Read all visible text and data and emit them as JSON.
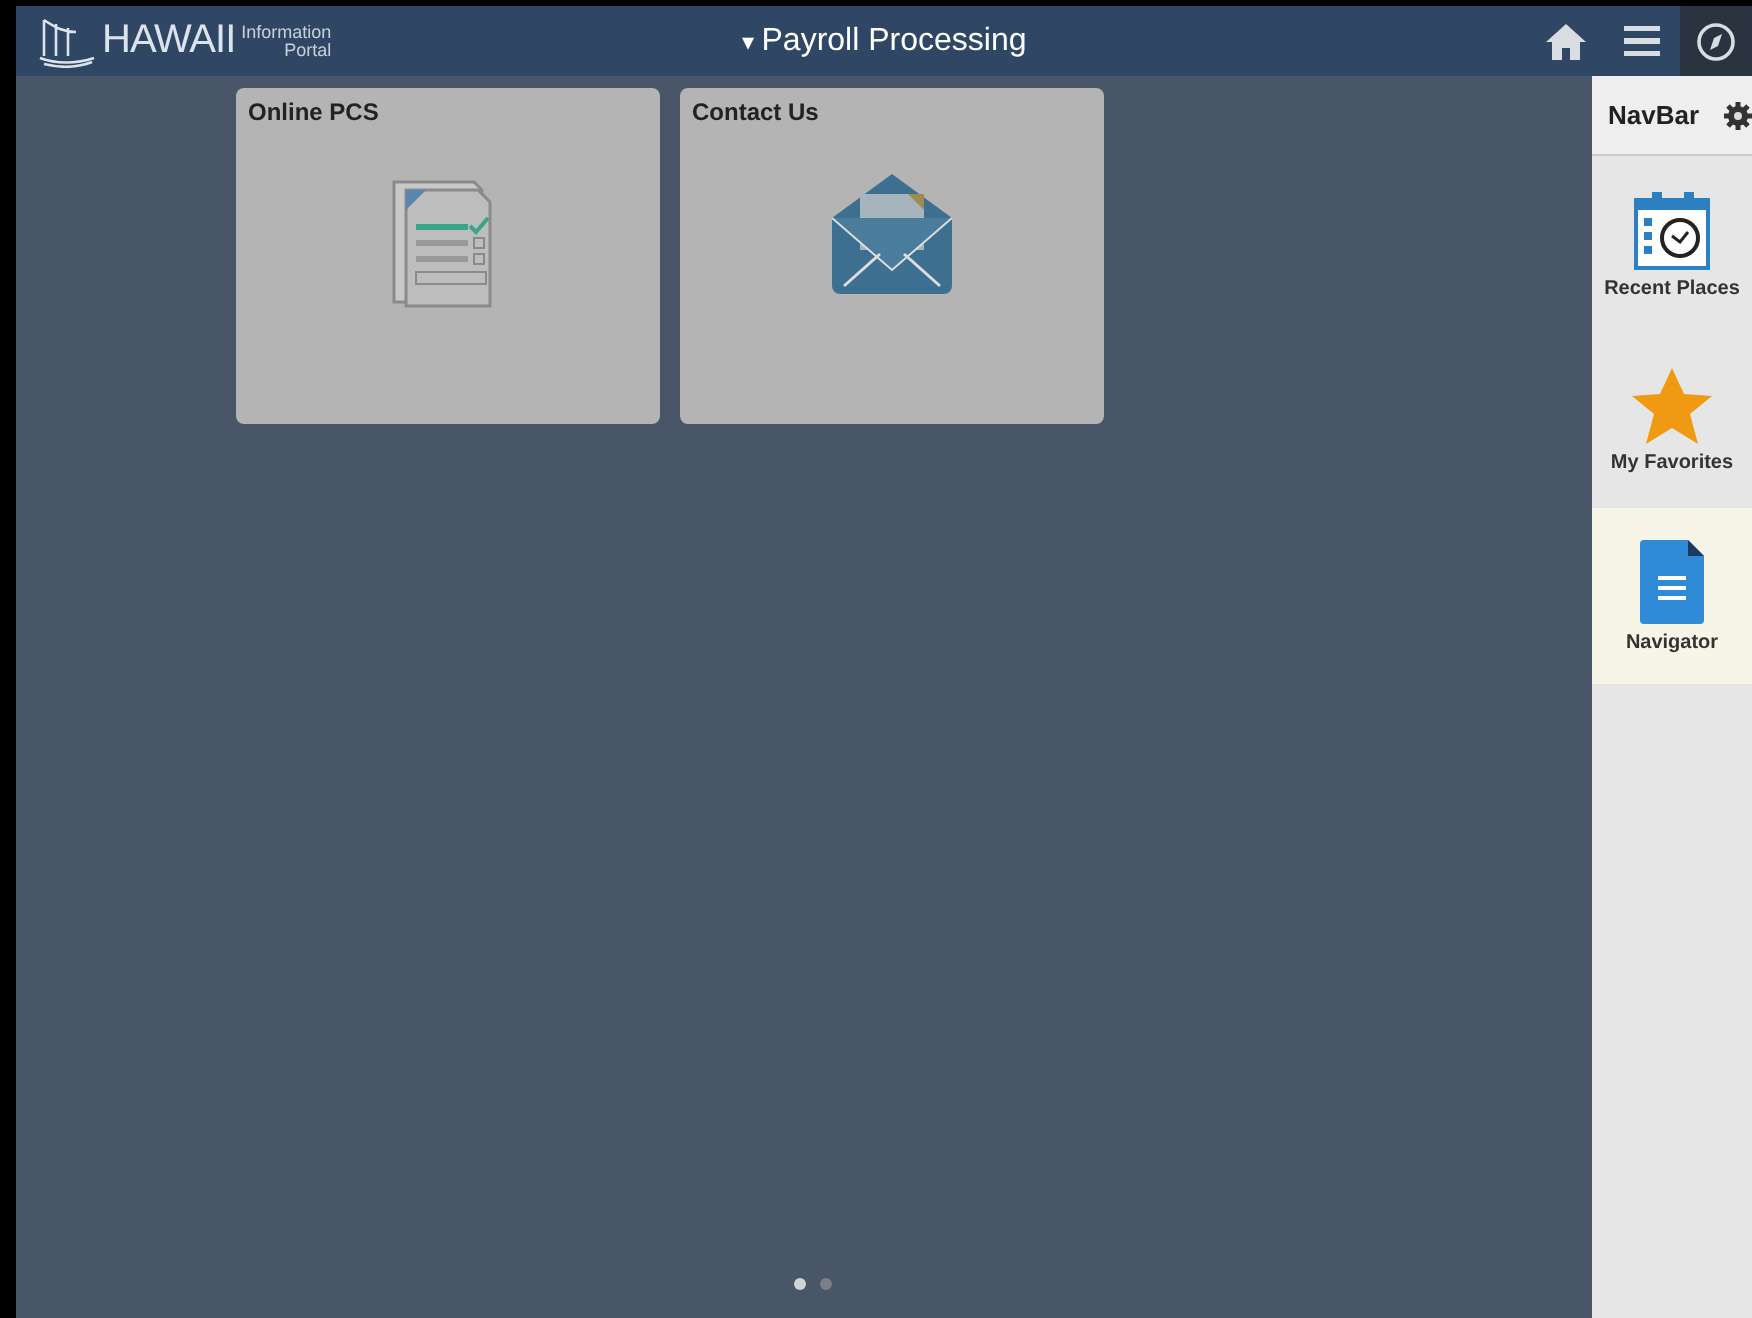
{
  "header": {
    "logo_text": "HAWAII",
    "logo_subtitle_1": "Information",
    "logo_subtitle_2": "Portal",
    "title": "Payroll Processing",
    "title_caret": "▾"
  },
  "tiles": [
    {
      "title": "Online PCS",
      "kind": "document"
    },
    {
      "title": "Contact Us",
      "kind": "mail"
    }
  ],
  "pager": [
    {
      "selected": true
    },
    {
      "selected": false
    }
  ],
  "navbar": {
    "title": "NavBar",
    "items": [
      {
        "label": "Recent Places",
        "kind": "recent",
        "selected": false
      },
      {
        "label": "My Favorites",
        "kind": "favorites",
        "selected": false
      },
      {
        "label": "Navigator",
        "kind": "navigator",
        "selected": true
      }
    ]
  }
}
